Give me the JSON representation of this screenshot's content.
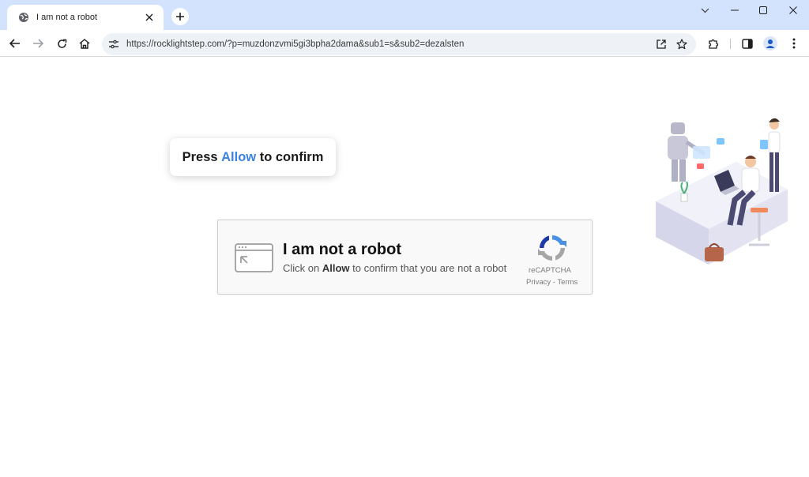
{
  "browser": {
    "tab_title": "I am not a robot",
    "url": "https://rocklightstep.com/?p=muzdonzvmi5gi3bpha2dama&sub1=s&sub2=dezalsten"
  },
  "page": {
    "press_prefix": "Press ",
    "press_allow": "Allow",
    "press_suffix": " to confirm",
    "captcha_heading": "I am not a robot",
    "captcha_sub_prefix": "Click on ",
    "captcha_sub_allow": "Allow",
    "captcha_sub_suffix": " to confirm that you are not a robot",
    "recaptcha_label": "reCAPTCHA",
    "recaptcha_links": "Privacy - Terms"
  },
  "colors": {
    "titlebar": "#d3e3fd",
    "accent_allow": "#3b82e6",
    "recaptcha_blue": "#4a90e2"
  },
  "icons": [
    "globe-icon",
    "close-icon",
    "plus-icon",
    "chevron-down-icon",
    "minimize-icon",
    "maximize-icon",
    "window-close-icon",
    "back-icon",
    "forward-icon",
    "reload-icon",
    "home-icon",
    "site-info-icon",
    "share-icon",
    "star-icon",
    "extensions-icon",
    "side-panel-icon",
    "profile-icon",
    "menu-icon",
    "window-icon",
    "recaptcha-icon"
  ]
}
